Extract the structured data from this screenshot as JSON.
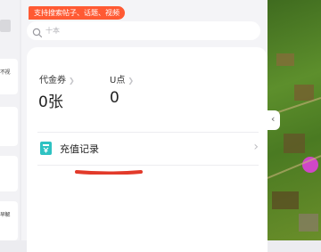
{
  "left_panel": {
    "label_1": "不视",
    "label_2": "早解"
  },
  "search": {
    "hint_tag": "支持搜索帖子、话题、视频",
    "placeholder": "十本"
  },
  "wallet": {
    "voucher_label": "代金券",
    "voucher_value": "0张",
    "u_points_label": "U点",
    "u_points_value": "0"
  },
  "recharge": {
    "label": "充值记录"
  },
  "colors": {
    "hint_tag_bg": "#ff5a33",
    "recharge_icon": "#2ec2c2",
    "underline": "#e23a2a"
  },
  "icons": {
    "search": "search-icon",
    "recharge": "recharge-card-icon",
    "chevron": "chevron-right-icon"
  }
}
